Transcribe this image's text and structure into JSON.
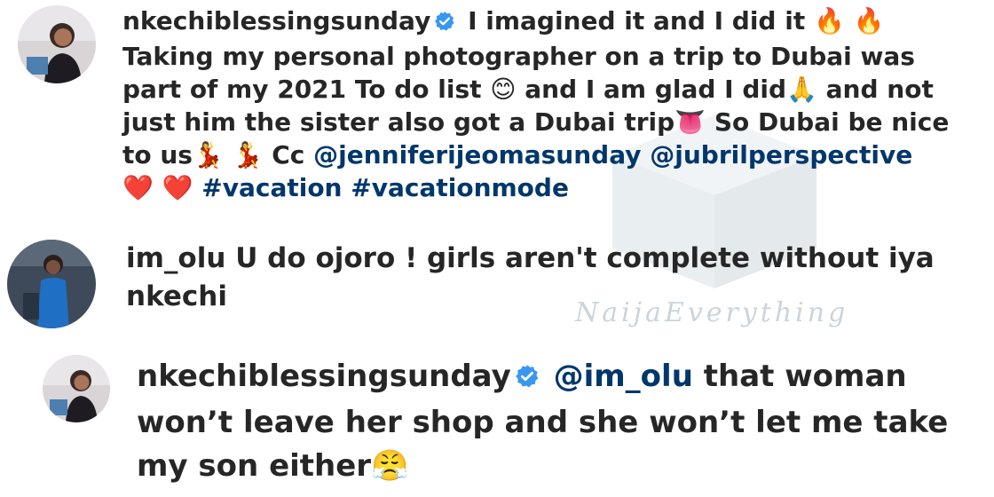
{
  "watermark": {
    "text": "NaijaEverything"
  },
  "comments": [
    {
      "username": "nkechiblessingsunday",
      "verified": true,
      "parts": {
        "p1": "I imagined it and I did it",
        "e1": "🔥 🔥",
        "p2": "Taking my personal photographer on a trip to Dubai was part of my 2021 To do list",
        "e2": "😊",
        "p3": "and I am glad I did",
        "e3": "🙏",
        "p4": "and not just him the sister also got a Dubai trip",
        "e4": "👅",
        "p5": "So Dubai be nice to us",
        "e5": "💃 💃",
        "p6": "Cc",
        "m1": "@jenniferijeomasunday",
        "m2": "@jubrilperspective",
        "e6": "❤️ ❤️",
        "t1": "#vacation",
        "t2": "#vacationmode"
      }
    },
    {
      "username": "im_olu",
      "verified": false,
      "parts": {
        "p1": "U do ojoro ! girls aren't complete without iya nkechi"
      }
    },
    {
      "username": "nkechiblessingsunday",
      "verified": true,
      "parts": {
        "m1": "@im_olu",
        "p1": "that woman won’t leave her shop and she won’t let me take my son either",
        "e1": "😤"
      }
    }
  ],
  "colors": {
    "verified_badge": "#3897f0",
    "link": "#00376b",
    "text": "#262626"
  }
}
